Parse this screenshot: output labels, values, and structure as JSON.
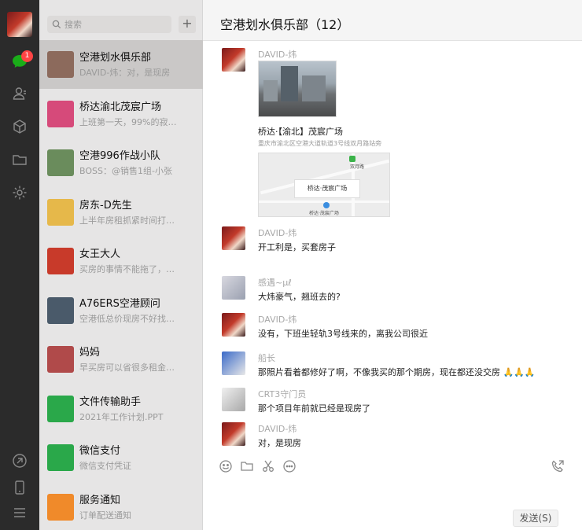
{
  "sidebar": {
    "unread_count": "1",
    "icons": [
      "chat-icon",
      "contacts-icon",
      "box-icon",
      "folder-icon",
      "settings-icon",
      "moments-icon",
      "phone-icon",
      "menu-icon"
    ]
  },
  "search": {
    "placeholder": "搜索",
    "add_label": "+"
  },
  "conversations": [
    {
      "name": "空港划水俱乐部",
      "preview": "DAVID-炜：对，是现房",
      "color": "#8c6a5c"
    },
    {
      "name": "桥达渝北茂宸广场",
      "preview": "上班第一天，99%的寂…",
      "color": "#d64a7a"
    },
    {
      "name": "空港996作战小队",
      "preview": "BOSS：@销售1组-小张",
      "color": "#6a8c5c"
    },
    {
      "name": "房东-D先生",
      "preview": "上半年房租抓紧时间打…",
      "color": "#e6b84a"
    },
    {
      "name": "女王大人",
      "preview": "买房的事情不能拖了，…",
      "color": "#c83a2a"
    },
    {
      "name": "A76ERS空港顾问",
      "preview": "空港低总价现房不好找…",
      "color": "#4a5a6a"
    },
    {
      "name": "妈妈",
      "preview": "早买房可以省很多租金…",
      "color": "#b04a4a"
    },
    {
      "name": "文件传输助手",
      "preview": "2021年工作计划.PPT",
      "color": "#2aa84a"
    },
    {
      "name": "微信支付",
      "preview": "微信支付凭证",
      "color": "#2aa84a"
    },
    {
      "name": "服务通知",
      "preview": "订单配送通知",
      "color": "#f08a2a"
    }
  ],
  "chat": {
    "title": "空港划水俱乐部（12）",
    "location": {
      "title": "桥达·【渝北】茂宸广场",
      "address": "重庆市渝北区空港大道轨道3号线双月路站旁",
      "map_label": "桥达·茂宸广场",
      "poi_1": "双月路",
      "poi_2": "桥达·茂宸广场"
    },
    "messages": [
      {
        "sender": "DAVID-炜",
        "text": ""
      },
      {
        "sender": "DAVID-炜",
        "text": "开工利是，买套房子"
      },
      {
        "sender": "感遇~μℓ",
        "text": "大炜豪气，翘班去的?"
      },
      {
        "sender": "DAVID-炜",
        "text": "没有，下班坐轻轨3号线来的，离我公司很近"
      },
      {
        "sender": "船长",
        "text": "那照片看着都修好了啊，不像我买的那个期房，现在都还没交房 🙏🙏🙏"
      },
      {
        "sender": "CRT3守门员",
        "text": "那个项目年前就已经是现房了"
      },
      {
        "sender": "DAVID-炜",
        "text": "对，是现房"
      }
    ],
    "send_label": "发送(S)"
  }
}
